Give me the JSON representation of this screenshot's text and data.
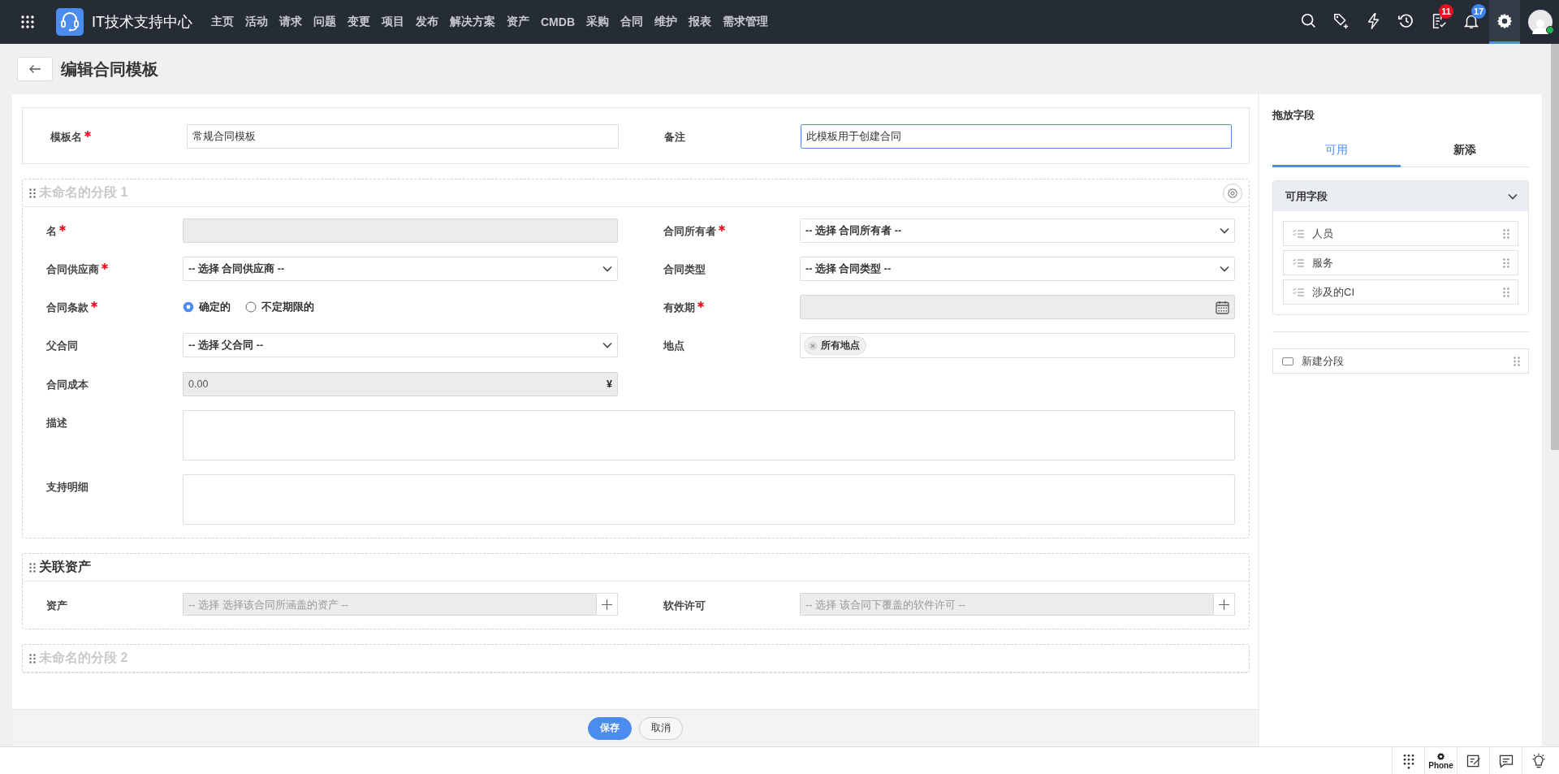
{
  "top_bar": {
    "app_title": "IT技术支持中心",
    "nav": [
      {
        "label": "主页"
      },
      {
        "label": "活动"
      },
      {
        "label": "请求"
      },
      {
        "label": "问题"
      },
      {
        "label": "变更"
      },
      {
        "label": "项目"
      },
      {
        "label": "发布"
      },
      {
        "label": "解决方案"
      },
      {
        "label": "资产"
      },
      {
        "label": "CMDB"
      },
      {
        "label": "采购"
      },
      {
        "label": "合同"
      },
      {
        "label": "维护"
      },
      {
        "label": "报表"
      },
      {
        "label": "需求管理"
      }
    ],
    "actions": [
      {
        "kind": "search",
        "selected": false
      },
      {
        "kind": "tag-add",
        "selected": false
      },
      {
        "kind": "bolt",
        "selected": false
      },
      {
        "kind": "history",
        "selected": false
      },
      {
        "kind": "tasks",
        "selected": false,
        "badge": "11",
        "color": "#e81123"
      },
      {
        "kind": "bell",
        "selected": false,
        "badge": "17",
        "color": "#3d85f0"
      },
      {
        "kind": "settings",
        "selected": true
      }
    ],
    "user": {
      "online": true
    }
  },
  "page": {
    "title": "编辑合同模板"
  },
  "template": {
    "fields": [
      {
        "label": "模板名",
        "required": true,
        "value": "常规合同模板",
        "focused": false
      },
      {
        "label": "备注",
        "required": false,
        "value": "此模板用于创建合同",
        "focused": true
      }
    ]
  },
  "sections": [
    {
      "title": "未命名的分段 1",
      "untitled": true,
      "settings": true,
      "fields": [
        {
          "kind": "text",
          "label": "名",
          "required": true,
          "disabled": true
        },
        {
          "kind": "select",
          "label": "合同所有者",
          "required": true,
          "disabled": false,
          "placeholder": "-- 选择 合同所有者 --"
        },
        {
          "kind": "select",
          "label": "合同供应商",
          "required": true,
          "disabled": false,
          "placeholder": "-- 选择 合同供应商 --"
        },
        {
          "kind": "select",
          "label": "合同类型",
          "required": false,
          "disabled": false,
          "placeholder": "-- 选择 合同类型 --"
        },
        {
          "kind": "radio",
          "label": "合同条款",
          "required": true,
          "disabled": false,
          "options": [
            {
              "label": "确定的",
              "selected": true
            },
            {
              "label": "不定期限的",
              "selected": false
            }
          ]
        },
        {
          "kind": "date",
          "label": "有效期",
          "required": true,
          "disabled": true
        },
        {
          "kind": "select",
          "label": "父合同",
          "required": false,
          "disabled": false,
          "placeholder": "-- 选择 父合同 --"
        },
        {
          "kind": "tags",
          "label": "地点",
          "required": false,
          "disabled": false,
          "tags": [
            "所有地点"
          ]
        },
        {
          "kind": "currency",
          "label": "合同成本",
          "required": false,
          "disabled": true,
          "value": "0.00",
          "symbol": "¥"
        },
        {
          "kind": "textarea",
          "label": "描述",
          "required": false,
          "disabled": false
        },
        {
          "kind": "textarea",
          "label": "支持明细",
          "required": false,
          "disabled": false
        }
      ]
    },
    {
      "title": "关联资产",
      "untitled": false,
      "settings": false,
      "fields": [
        {
          "kind": "lookup",
          "label": "资产",
          "required": false,
          "disabled": true,
          "placeholder": "-- 选择 选择该合同所涵盖的资产 --"
        },
        {
          "kind": "lookup",
          "label": "软件许可",
          "required": false,
          "disabled": true,
          "placeholder": "-- 选择 该合同下覆盖的软件许可 --"
        }
      ]
    },
    {
      "title": "未命名的分段 2",
      "untitled": true,
      "settings": false
    }
  ],
  "right_panel": {
    "title": "拖放字段",
    "tabs": [
      {
        "label": "可用",
        "selected": true
      },
      {
        "label": "新添",
        "selected": false
      }
    ],
    "group": {
      "title": "可用字段",
      "expanded": true,
      "items": [
        {
          "label": "人员"
        },
        {
          "label": "服务"
        },
        {
          "label": "涉及的CI"
        }
      ]
    },
    "new_section": {
      "label": "新建分段"
    }
  },
  "footer": {
    "buttons": [
      {
        "label": "保存",
        "kind": "primary"
      },
      {
        "label": "取消",
        "kind": "secondary"
      }
    ]
  },
  "status_bar": {
    "items": [
      {
        "kind": "dialpad"
      },
      {
        "kind": "phone",
        "label": "Phone"
      },
      {
        "kind": "note"
      },
      {
        "kind": "chat"
      },
      {
        "kind": "idea"
      }
    ]
  }
}
